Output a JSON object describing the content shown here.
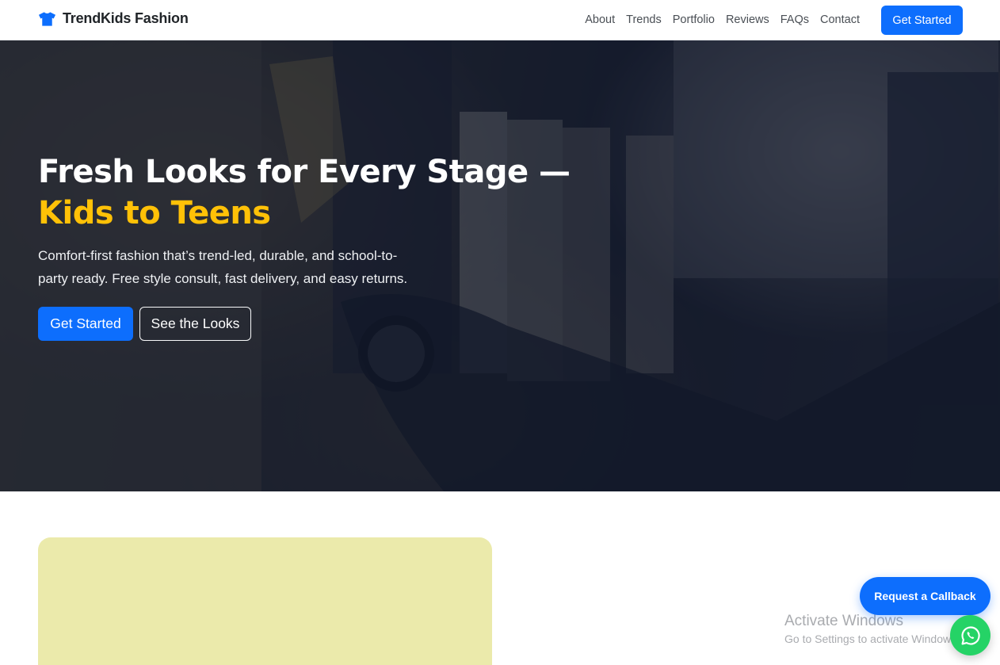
{
  "brand": {
    "name": "TrendKids Fashion",
    "icon": "tshirt-icon",
    "color": "#0d6efd"
  },
  "nav": {
    "links": [
      "About",
      "Trends",
      "Portfolio",
      "Reviews",
      "FAQs",
      "Contact"
    ],
    "cta_label": "Get Started"
  },
  "hero": {
    "title_main": "Fresh Looks for Every Stage — ",
    "title_accent": "Kids to Teens",
    "subtitle": "Comfort-first fashion that’s trend-led, durable, and school-to-party ready. Free style consult, fast delivery, and easy returns.",
    "primary_button": "Get Started",
    "secondary_button": "See the Looks",
    "accent_color": "#ffc107"
  },
  "floating": {
    "callback_label": "Request a Callback",
    "whatsapp_icon": "whatsapp-icon"
  },
  "watermark": {
    "title": "Activate Windows",
    "subtitle": "Go to Settings to activate Windows."
  },
  "colors": {
    "primary": "#0d6efd",
    "accent": "#ffc107",
    "whatsapp": "#25d366",
    "card": "#ebeaab"
  }
}
